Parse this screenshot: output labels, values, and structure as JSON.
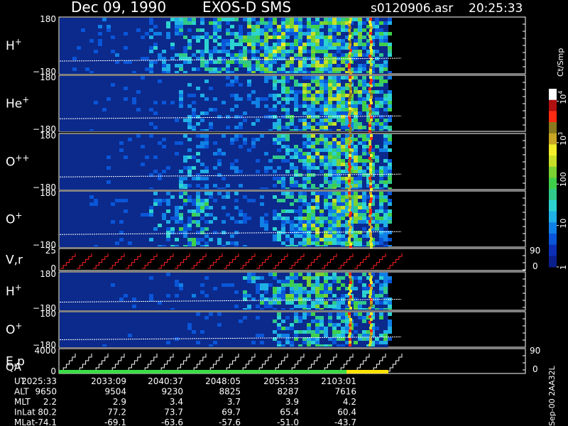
{
  "header": {
    "date": "Dec 09, 1990",
    "mission": "EXOS-D SMS",
    "filename": "s0120906.asr",
    "time": "20:25:33"
  },
  "colors": {
    "background": "#000000",
    "panel_bg": "#0b2a8c",
    "white": "#ffffff",
    "red": "#ff2020",
    "qa_green": "#3ddc4a",
    "qa_yellow": "#ffe300"
  },
  "colorbar": {
    "unit": "Ct/Smp",
    "ticks": [
      "10",
      "10",
      "100",
      "10",
      "1"
    ],
    "tick_sups": [
      "4",
      "3",
      "",
      "",
      ""
    ],
    "tick_values": [
      10000,
      1000,
      100,
      10,
      1
    ],
    "min": 1,
    "max": 20000,
    "colors": [
      "#0a1f8c",
      "#0b2fb5",
      "#0a55d8",
      "#1080e6",
      "#1fb0e6",
      "#2cd3d0",
      "#30c98a",
      "#3fd04a",
      "#7ad233",
      "#c8e028",
      "#f2ef2a",
      "#c9a624",
      "#8a7a1e",
      "#ff2a12",
      "#b01010",
      "#ffffff"
    ]
  },
  "footer": {
    "rows": [
      {
        "label": "UT",
        "values": [
          "2025:33",
          "2033:09",
          "2040:37",
          "2048:05",
          "2055:33",
          "2103:01"
        ]
      },
      {
        "label": "ALT",
        "values": [
          "9650",
          "9504",
          "9230",
          "8825",
          "8287",
          "7616"
        ]
      },
      {
        "label": "MLT",
        "values": [
          "2.2",
          "2.9",
          "3.4",
          "3.7",
          "3.9",
          "4.2"
        ]
      },
      {
        "label": "InLat",
        "values": [
          "80.2",
          "77.2",
          "73.7",
          "69.7",
          "65.4",
          "60.4"
        ]
      },
      {
        "label": "MLat",
        "values": [
          "-74.1",
          "-69.1",
          "-63.6",
          "-57.6",
          "-51.0",
          "-43.7"
        ]
      }
    ],
    "side_label": "Sep-00 2AA32L"
  },
  "chart_data": {
    "type": "heatmap",
    "x_ticks": [
      "2025:33",
      "2033:09",
      "2040:37",
      "2048:05",
      "2055:33",
      "2103:01"
    ],
    "panels": [
      {
        "species": "H",
        "charge": "+",
        "y_top": "180",
        "y_bottom": "−180",
        "activity": [
          0.05,
          0.15,
          0.1,
          0.35,
          0.5,
          0.55,
          0.75,
          0.85,
          0.8,
          0.75,
          0.6
        ]
      },
      {
        "species": "He",
        "charge": "+",
        "y_top": "180",
        "y_bottom": "−180",
        "activity": [
          0,
          0.02,
          0.05,
          0.1,
          0.3,
          0.2,
          0.25,
          0.55,
          0.8,
          0.8,
          0.6
        ]
      },
      {
        "species": "O",
        "charge": "++",
        "y_top": "180",
        "y_bottom": "−180",
        "activity": [
          0,
          0.02,
          0.05,
          0.1,
          0.35,
          0.2,
          0.2,
          0.5,
          0.75,
          0.8,
          0.6
        ]
      },
      {
        "species": "O",
        "charge": "+",
        "y_top": "180",
        "y_bottom": "−180",
        "activity": [
          0,
          0.05,
          0.1,
          0.35,
          0.55,
          0.3,
          0.2,
          0.5,
          0.8,
          0.8,
          0.6
        ]
      },
      {
        "species": "V,r",
        "charge": "",
        "y_top": "25",
        "y_bottom": "0",
        "right_top": "90",
        "right_bottom": "0",
        "kind": "line"
      },
      {
        "species": "H",
        "charge": "+",
        "y_top": "180",
        "y_bottom": "−180",
        "activity": [
          0,
          0.02,
          0.08,
          0.1,
          0.15,
          0.1,
          0.55,
          0.65,
          0.7,
          0.65,
          0.5
        ]
      },
      {
        "species": "O",
        "charge": "+",
        "y_top": "180",
        "y_bottom": "−180",
        "activity": [
          0,
          0.01,
          0.02,
          0.05,
          0.05,
          0.05,
          0.1,
          0.55,
          0.6,
          0.6,
          0.55
        ]
      },
      {
        "species": "E,p",
        "charge": "",
        "y_top": "4000",
        "y_bottom": "0",
        "right_top": "90",
        "right_bottom": "0",
        "kind": "line",
        "sublabel": "QA"
      }
    ]
  }
}
